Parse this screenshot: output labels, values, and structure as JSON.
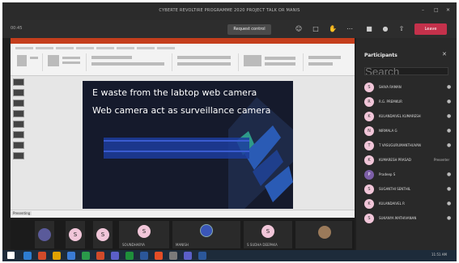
{
  "window": {
    "title": "CYBERTE REVOLTIRE PROGRAMME 2020 PROJECT TALK OR MANIS"
  },
  "toolbar": {
    "timer": "00:45",
    "request_control_label": "Request control",
    "leave_label": "Leave"
  },
  "slide": {
    "line1": "E waste from the labtop web camera",
    "line2": "Web camera act as surveillance camera"
  },
  "presenter_label": "Presenting",
  "bottom_strip": {
    "tiles": [
      {
        "initial": "",
        "name": ""
      },
      {
        "initial": "S",
        "name": ""
      },
      {
        "initial": "S",
        "name": ""
      },
      {
        "initial": "S",
        "name": "SOUNDHARYA"
      },
      {
        "initial": "",
        "name": "MANISH"
      },
      {
        "initial": "S",
        "name": "S SUDHA DEEPAKA"
      },
      {
        "initial": "",
        "name": ""
      }
    ]
  },
  "participants_panel": {
    "title": "Participants",
    "search_placeholder": "Search",
    "people": [
      {
        "initial": "S",
        "name": "SHIVA RAMAN",
        "tag": ""
      },
      {
        "initial": "R",
        "name": "R.G. PREMKUR",
        "tag": ""
      },
      {
        "initial": "K",
        "name": "KULANDAIVEL KUMARESH",
        "tag": ""
      },
      {
        "initial": "N",
        "name": "NIRMALA G",
        "tag": ""
      },
      {
        "initial": "T",
        "name": "T VASUGURUMANTHUVAN",
        "tag": ""
      },
      {
        "initial": "K",
        "name": "KUMARESH PRASAD",
        "tag": "Presenter"
      },
      {
        "initial": "P",
        "name": "Pradeep S",
        "tag": ""
      },
      {
        "initial": "S",
        "name": "SUGANTHI SENTHIL",
        "tag": ""
      },
      {
        "initial": "K",
        "name": "KULANDAIVEL R",
        "tag": ""
      },
      {
        "initial": "S",
        "name": "SUKANYA MATHIVANAN",
        "tag": ""
      }
    ]
  },
  "taskbar": {
    "clock": "11:51 AM"
  },
  "colors": {
    "leave": "#c4314b",
    "ppt_brand": "#c43e1c",
    "slide_bg": "#151a2c",
    "selection": "#1c3d9e"
  }
}
